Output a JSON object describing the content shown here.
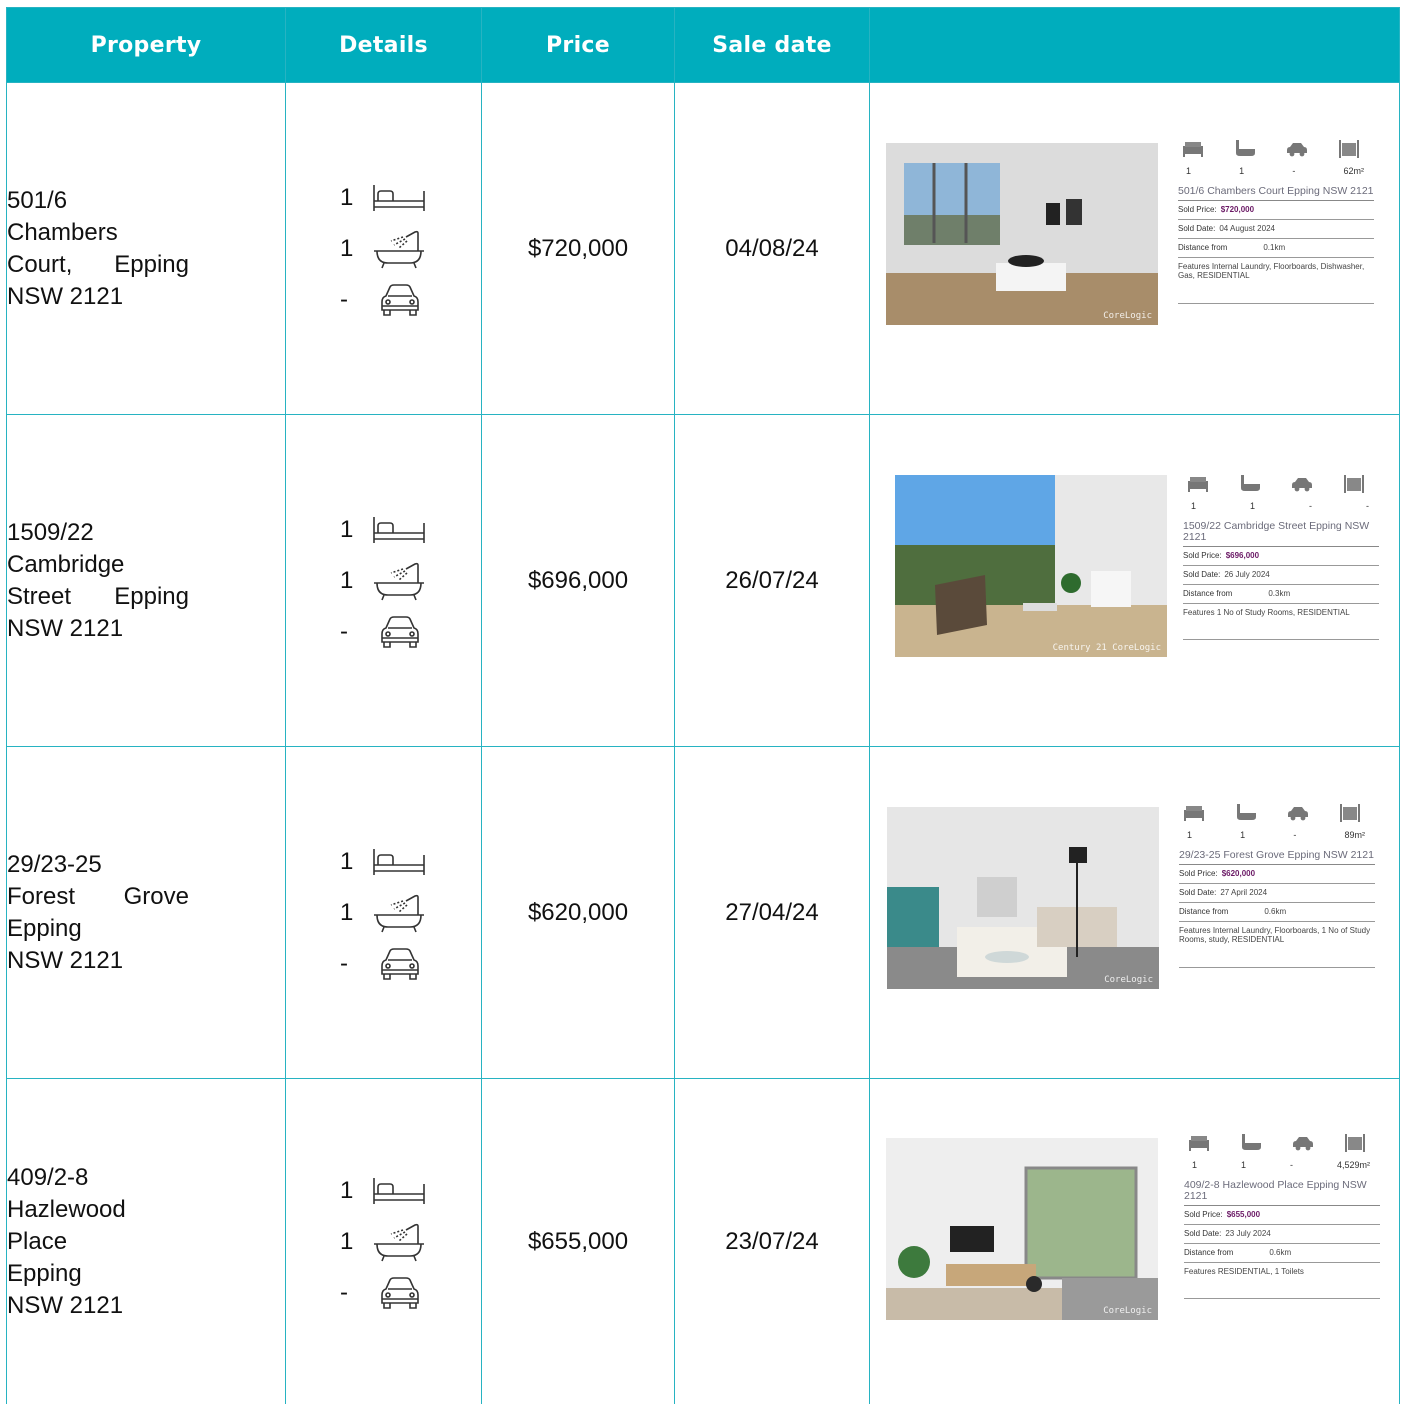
{
  "headers": [
    "Property",
    "Details",
    "Price",
    "Sale date",
    ""
  ],
  "icons": {
    "bed": "bed-icon",
    "bath": "bath-icon",
    "car": "car-icon",
    "land": "land-size-icon"
  },
  "colors": {
    "header_bg": "#00adbd",
    "border": "#27b3c2",
    "sold_price": "#6b1a66"
  },
  "rows": [
    {
      "address_lines": [
        "501/6",
        "Chambers",
        "Court,|Epping",
        "NSW 2121"
      ],
      "beds": "1",
      "baths": "1",
      "cars": "-",
      "price": "$720,000",
      "sale_date": "04/08/24",
      "card": {
        "beds": "1",
        "baths": "1",
        "cars": "-",
        "land": "62m²",
        "address": "501/6 Chambers Court Epping NSW 2121",
        "sold_price_label": "Sold Price:",
        "sold_price": "$720,000",
        "sold_date_label": "Sold Date:",
        "sold_date": "04 August 2024",
        "distance_label": "Distance from",
        "distance": "0.1km",
        "features_label": "Features",
        "features": "Internal Laundry, Floorboards, Dishwasher, Gas, RESIDENTIAL",
        "watermark": "CoreLogic"
      }
    },
    {
      "address_lines": [
        "1509/22",
        "Cambridge",
        "Street|Epping",
        "NSW 2121"
      ],
      "beds": "1",
      "baths": "1",
      "cars": "-",
      "price": "$696,000",
      "sale_date": "26/07/24",
      "card": {
        "beds": "1",
        "baths": "1",
        "cars": "-",
        "land": "-",
        "address": "1509/22 Cambridge Street Epping NSW 2121",
        "sold_price_label": "Sold Price:",
        "sold_price": "$696,000",
        "sold_date_label": "Sold Date:",
        "sold_date": "26 July 2024",
        "distance_label": "Distance from",
        "distance": "0.3km",
        "features_label": "Features",
        "features": "1 No of Study Rooms, RESIDENTIAL",
        "watermark": "Century 21 CoreLogic"
      }
    },
    {
      "address_lines": [
        "29/23-25",
        "Forest|Grove",
        "Epping",
        "NSW 2121"
      ],
      "beds": "1",
      "baths": "1",
      "cars": "-",
      "price": "$620,000",
      "sale_date": "27/04/24",
      "card": {
        "beds": "1",
        "baths": "1",
        "cars": "-",
        "land": "89m²",
        "address": "29/23-25 Forest Grove Epping NSW 2121",
        "sold_price_label": "Sold Price:",
        "sold_price": "$620,000",
        "sold_date_label": "Sold Date:",
        "sold_date": "27 April 2024",
        "distance_label": "Distance from",
        "distance": "0.6km",
        "features_label": "Features",
        "features": "Internal Laundry, Floorboards, 1 No of Study Rooms, study, RESIDENTIAL",
        "watermark": "CoreLogic"
      }
    },
    {
      "address_lines": [
        "409/2-8",
        "Hazlewood",
        "Place",
        "Epping",
        "NSW 2121"
      ],
      "beds": "1",
      "baths": "1",
      "cars": "-",
      "price": "$655,000",
      "sale_date": "23/07/24",
      "card": {
        "beds": "1",
        "baths": "1",
        "cars": "-",
        "land": "4,529m²",
        "address": "409/2-8 Hazlewood Place Epping NSW 2121",
        "sold_price_label": "Sold Price:",
        "sold_price": "$655,000",
        "sold_date_label": "Sold Date:",
        "sold_date": "23 July 2024",
        "distance_label": "Distance from",
        "distance": "0.6km",
        "features_label": "Features",
        "features": "RESIDENTIAL, 1 Toilets",
        "watermark": "CoreLogic"
      }
    }
  ]
}
